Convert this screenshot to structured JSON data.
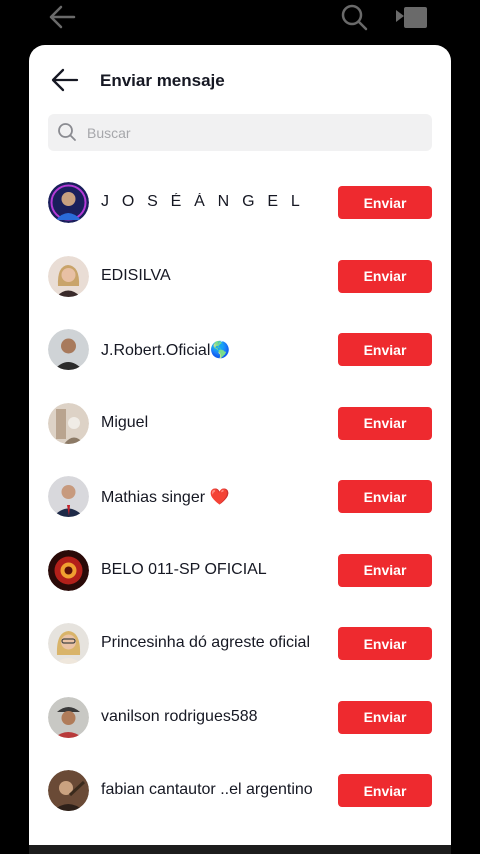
{
  "header": {
    "title": "Enviar mensaje"
  },
  "search": {
    "placeholder": "Buscar"
  },
  "send_label": "Enviar",
  "contacts": [
    {
      "name": "J O S É  Á N G E L",
      "avatar": "avatar-blue"
    },
    {
      "name": "EDISILVA",
      "avatar": "avatar-blonde"
    },
    {
      "name": "J.Robert.Oficial🌎",
      "avatar": "avatar-man-gray"
    },
    {
      "name": "Miguel",
      "avatar": "avatar-light"
    },
    {
      "name": "Mathias singer ❤️",
      "avatar": "avatar-suit"
    },
    {
      "name": "BELO 011-SP OFICIAL",
      "avatar": "avatar-red"
    },
    {
      "name": "Princesinha dó agreste oficial",
      "avatar": "avatar-woman-glasses"
    },
    {
      "name": "vanilson rodrigues588",
      "avatar": "avatar-man-hat"
    },
    {
      "name": "fabian cantautor ..el argentino",
      "avatar": "avatar-brown"
    }
  ],
  "colors": {
    "accent": "#ee2a2f",
    "text": "#161823",
    "placeholder": "#a6a7ab"
  }
}
